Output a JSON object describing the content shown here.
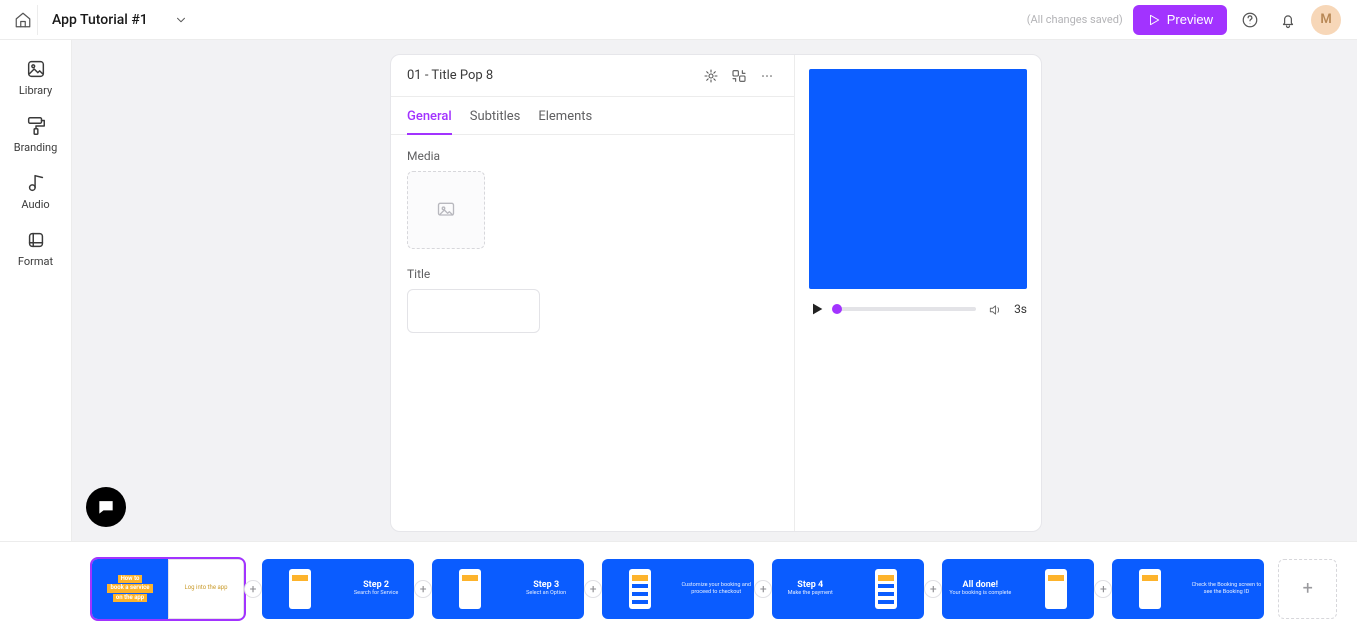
{
  "colors": {
    "accent": "#a233ff",
    "brand_blue": "#0a5cff",
    "tag_yellow": "#fdb32b"
  },
  "header": {
    "title": "App Tutorial #1",
    "saved_text": "(All changes saved)",
    "preview_btn": "Preview",
    "avatar_initial": "M"
  },
  "sidebar": {
    "items": [
      {
        "icon": "image-stack-icon",
        "label": "Library"
      },
      {
        "icon": "paint-roller-icon",
        "label": "Branding"
      },
      {
        "icon": "music-note-icon",
        "label": "Audio"
      },
      {
        "icon": "crop-icon",
        "label": "Format"
      }
    ]
  },
  "editor_panel": {
    "scene_title": "01 - Title Pop 8",
    "tabs": [
      {
        "id": "general",
        "label": "General",
        "active": true
      },
      {
        "id": "subtitles",
        "label": "Subtitles",
        "active": false
      },
      {
        "id": "elements",
        "label": "Elements",
        "active": false
      }
    ],
    "fields": {
      "media_label": "Media",
      "title_label": "Title",
      "title_value": ""
    }
  },
  "preview": {
    "duration_label": "3s",
    "progress": 0
  },
  "timeline": {
    "scenes": [
      {
        "selected": true,
        "left": {
          "kind": "title-card",
          "lines": [
            "How to",
            "book a service",
            "on the app"
          ]
        },
        "right": {
          "kind": "white-text",
          "text": "Log into the app"
        }
      },
      {
        "selected": false,
        "left": {
          "kind": "phone"
        },
        "right": {
          "kind": "step",
          "step": "Step 2",
          "caption": "Search for Service"
        }
      },
      {
        "selected": false,
        "left": {
          "kind": "phone"
        },
        "right": {
          "kind": "step",
          "step": "Step 3",
          "caption": "Select an Option"
        }
      },
      {
        "selected": false,
        "left": {
          "kind": "phone-rows"
        },
        "right": {
          "kind": "step-small",
          "step": "",
          "caption": "Customize your booking and proceed to checkout"
        }
      },
      {
        "selected": false,
        "left": {
          "kind": "step",
          "step": "Step 4",
          "caption": "Make the payment"
        },
        "right": {
          "kind": "phone-rows"
        }
      },
      {
        "selected": false,
        "left": {
          "kind": "step",
          "step": "All done!",
          "caption": "Your booking is complete"
        },
        "right": {
          "kind": "phone"
        }
      },
      {
        "selected": false,
        "left": {
          "kind": "phone"
        },
        "right": {
          "kind": "caption-only",
          "caption": "Check the Booking screen to see the Booking ID"
        }
      }
    ]
  }
}
